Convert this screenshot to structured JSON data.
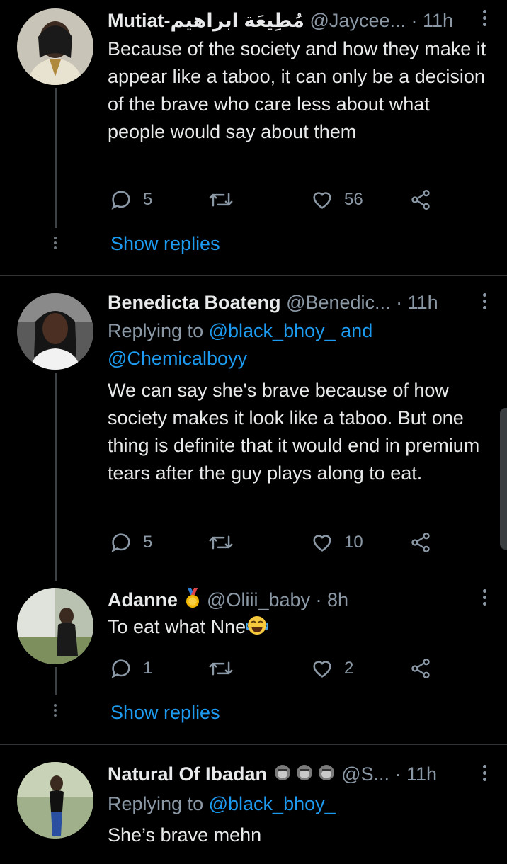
{
  "colors": {
    "background": "#000000",
    "text": "#e7e9ea",
    "muted": "#8b98a5",
    "accent": "#1d9bf0"
  },
  "tweets": [
    {
      "name": "Mutiat-مُطِيعَة ابراهيم",
      "handle": "@Jaycee...",
      "time": "· 11h",
      "text": "Because of the society and how they make it appear like a taboo, it can only be a decision of the brave who care less about what people would say about them",
      "replies": "5",
      "retweets": "",
      "likes": "56",
      "show_replies": "Show replies"
    },
    {
      "name": "Benedicta Boateng",
      "handle": "@Benedic...",
      "time": "· 11h",
      "replying_label": "Replying to",
      "replying_mention_1": "@black_bhoy_",
      "replying_and": "and",
      "replying_mention_2": "@Chemicalboyy",
      "text": "We can say she's brave because of how society makes it look like a taboo. But one thing is definite that it would end in premium tears after the guy plays along to eat.",
      "replies": "5",
      "retweets": "",
      "likes": "10"
    },
    {
      "name": "Adanne",
      "name_emoji": "medal-emoji",
      "handle": "@Oliii_baby",
      "time": "· 8h",
      "text": "To eat what Nne",
      "text_emoji": "joy-emoji",
      "replies": "1",
      "retweets": "",
      "likes": "2",
      "show_replies": "Show replies"
    },
    {
      "name": "Natural Of Ibadan",
      "name_emoji": "monkey-emoji",
      "handle": "@S...",
      "time": "· 11h",
      "replying_label": "Replying to",
      "replying_mention_1": "@black_bhoy_",
      "text": "She’s brave mehn"
    }
  ]
}
